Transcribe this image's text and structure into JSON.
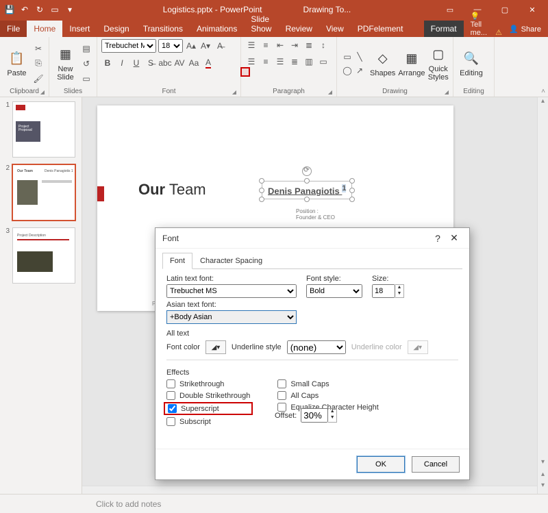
{
  "title": {
    "document": "Logistics.pptx - PowerPoint",
    "context": "Drawing To..."
  },
  "menu": {
    "file": "File",
    "home": "Home",
    "insert": "Insert",
    "design": "Design",
    "transitions": "Transitions",
    "animations": "Animations",
    "slideshow": "Slide Show",
    "review": "Review",
    "view": "View",
    "pdfelement": "PDFelement",
    "format": "Format",
    "tellme": "Tell me...",
    "share": "Share"
  },
  "ribbon": {
    "clipboard": {
      "label": "Clipboard",
      "paste": "Paste"
    },
    "slides": {
      "label": "Slides",
      "newslide": "New\nSlide"
    },
    "font": {
      "label": "Font",
      "family": "Trebuchet MS",
      "size": "18"
    },
    "paragraph": {
      "label": "Paragraph"
    },
    "drawing": {
      "label": "Drawing",
      "shapes": "Shapes",
      "arrange": "Arrange",
      "quick": "Quick\nStyles"
    },
    "editing": {
      "label": "Editing",
      "btn": "Editing"
    }
  },
  "slide": {
    "our": "Our",
    "team": " Team",
    "personname": "Denis Panagiotis ",
    "sup": "1",
    "positionlabel": "Position  :",
    "positionval": "Founder & CEO",
    "pagefooter": "Page : 2"
  },
  "notes": {
    "placeholder": "Click to add notes"
  },
  "thumbs": {
    "t1": "1",
    "t2": "2",
    "t3": "3",
    "s1a": "Project",
    "s1b": "Proposal",
    "s2a": "Our Team",
    "s2b": "Denis Panagiotis 1",
    "s3a": "Project Description"
  },
  "dialog": {
    "title": "Font",
    "help": "?",
    "close": "✕",
    "tab_font": "Font",
    "tab_spacing": "Character Spacing",
    "latin_label": "Latin text font:",
    "latin_value": "Trebuchet MS",
    "asian_label": "Asian text font:",
    "asian_value": "+Body Asian",
    "style_label": "Font style:",
    "style_value": "Bold",
    "size_label": "Size:",
    "size_value": "18",
    "alltext": "All text",
    "fontcolor_label": "Font color",
    "underline_label": "Underline style",
    "underline_value": "(none)",
    "ulcolor_label": "Underline color",
    "effects": "Effects",
    "strike": "Strikethrough",
    "dstrike": "Double Strikethrough",
    "super": "Superscript",
    "sub": "Subscript",
    "offset_label": "Offset:",
    "offset_value": "30%",
    "smallcaps": "Small Caps",
    "allcaps": "All Caps",
    "eqheight": "Equalize Character Height",
    "ok": "OK",
    "cancel": "Cancel"
  }
}
